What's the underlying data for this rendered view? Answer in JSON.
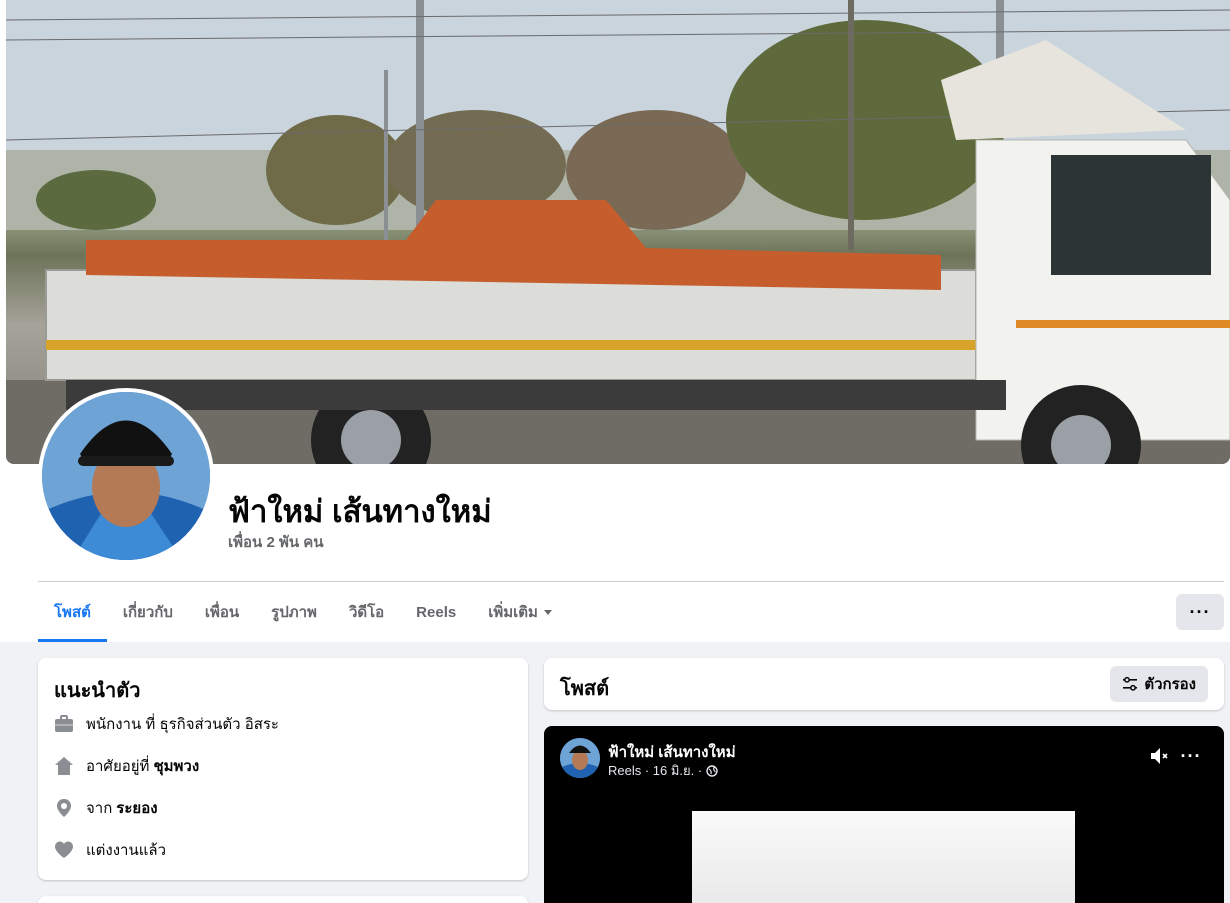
{
  "profile": {
    "name": "ฟ้าใหม่ เส้นทางใหม่",
    "friends": "เพื่อน 2 พัน คน"
  },
  "tabs": [
    {
      "label": "โพสต์",
      "active": true
    },
    {
      "label": "เกี่ยวกับ"
    },
    {
      "label": "เพื่อน"
    },
    {
      "label": "รูปภาพ"
    },
    {
      "label": "วิดีโอ"
    },
    {
      "label": "Reels"
    },
    {
      "label": "เพิ่มเติม"
    }
  ],
  "more_button": "···",
  "intro": {
    "title": "แนะนำตัว",
    "work": {
      "text": "พนักงาน ที่ ธุรกิจส่วนตัว อิสระ",
      "icon": "briefcase-icon"
    },
    "lives": {
      "prefix": "อาศัยอยู่ที่",
      "value": "ชุมพวง",
      "icon": "home-icon"
    },
    "from": {
      "prefix": "จาก",
      "value": "ระยอง",
      "icon": "location-pin-icon"
    },
    "relationship": {
      "text": "แต่งงานแล้ว",
      "icon": "heart-icon"
    }
  },
  "posts": {
    "title": "โพสต์",
    "filter_label": "ตัวกรอง"
  },
  "reel_post": {
    "author": "ฟ้าใหม่ เส้นทางใหม่",
    "meta": "Reels · 16 มิ.ย. ·",
    "more": "···"
  },
  "colors": {
    "accent": "#1877f2",
    "secondary_text": "#65676b",
    "page_bg": "#f0f2f5",
    "button_bg": "#e4e6eb"
  }
}
